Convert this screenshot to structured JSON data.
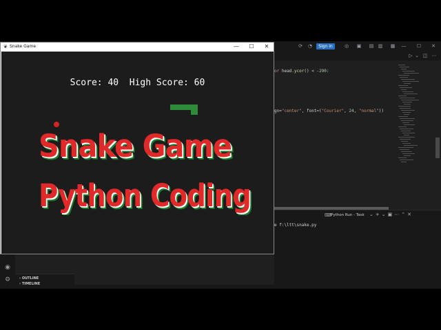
{
  "vscode": {
    "signin_label": "Sign in",
    "code_lines": [
      {
        "text": "or head.ycor() < -290:"
      },
      {
        "text": "gn=\"center\", font=(\"Courier\", 24, \"normal\"))"
      }
    ],
    "panel": {
      "tab_label": "Python Run - Task",
      "terminal_line": "e f:\\ltt\\snake.py"
    },
    "sidebar": {
      "outline_label": "OUTLINE",
      "timeline_label": "TIMELINE"
    }
  },
  "window": {
    "title": "Snake Game",
    "minimize": "—",
    "maximize": "☐",
    "close": "✕"
  },
  "game": {
    "score_text": "Score: 40  High Score: 60",
    "score": 40,
    "high_score": 60,
    "snake_color": "#2e8b3a",
    "food_color": "#d42424",
    "background": "#1c1c1c"
  },
  "overlay": {
    "line1": "Snake Game",
    "line2": "Python Coding",
    "color": "#e02a2a"
  }
}
